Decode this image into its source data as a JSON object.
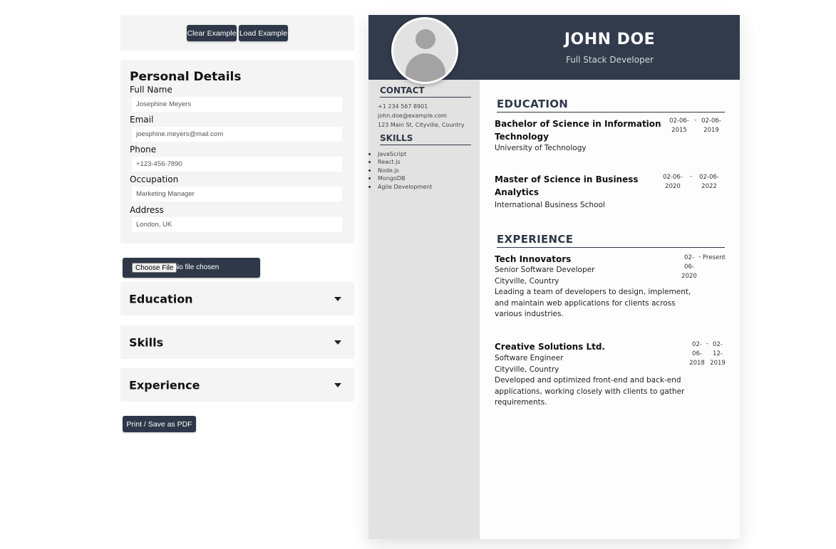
{
  "toolbar": {
    "clear_label": "Clear Example",
    "load_label": "Load Example"
  },
  "personal": {
    "title": "Personal Details",
    "fields": [
      {
        "label": "Full Name",
        "value": "Josephine Meyers"
      },
      {
        "label": "Email",
        "value": "joesphine.meyers@mail.com"
      },
      {
        "label": "Phone",
        "value": "+123-456-7890"
      },
      {
        "label": "Occupation",
        "value": "Marketing Manager"
      },
      {
        "label": "Address",
        "value": "London, UK"
      }
    ]
  },
  "file": {
    "button_label": "Choose File",
    "status": "No file chosen"
  },
  "accordions": [
    {
      "label": "Education"
    },
    {
      "label": "Skills"
    },
    {
      "label": "Experience"
    }
  ],
  "print_label": "Print / Save as PDF",
  "resume": {
    "name": "JOHN DOE",
    "role": "Full Stack Developer",
    "contact_heading": "CONTACT",
    "contact": {
      "phone": "+1 234 567 8901",
      "email": "john.doe@example.com",
      "address": "123 Main St, Cityville, Country"
    },
    "skills_heading": "SKILLS",
    "skills": [
      "JavaScript",
      "React.js",
      "Node.js",
      "MongoDB",
      "Agile Development"
    ],
    "education_heading": "EDUCATION",
    "education": [
      {
        "title_line1": "Bachelor of Science in Information",
        "title_line2": "Technology",
        "school": "University of Technology",
        "start1": "02-06-",
        "start2": "2015",
        "sep": "-",
        "end1": "02-06-",
        "end2": "2019"
      },
      {
        "title_line1": "Master of Science in Business",
        "title_line2": "Analytics",
        "school": "International Business School",
        "start1": "02-06-",
        "start2": "2020",
        "sep": "-",
        "end1": "02-06-",
        "end2": "2022"
      }
    ],
    "experience_heading": "EXPERIENCE",
    "experience": [
      {
        "company": "Tech Innovators",
        "position": "Senior Software Developer",
        "location": "Cityville, Country",
        "desc": [
          "Leading a team of developers to design, implement,",
          "and maintain web applications for clients across",
          "various industries."
        ],
        "start": [
          "02-",
          "06-",
          "2020"
        ],
        "sep": "-",
        "end": "Present"
      },
      {
        "company": "Creative Solutions Ltd.",
        "position": "Software Engineer",
        "location": "Cityville, Country",
        "desc": [
          "Developed and optimized front-end and back-end",
          "applications, working closely with clients to gather",
          "requirements."
        ],
        "start": [
          "02-",
          "06-",
          "2018"
        ],
        "sep": "-",
        "end": [
          "02-",
          "12-",
          "2019"
        ]
      }
    ]
  }
}
